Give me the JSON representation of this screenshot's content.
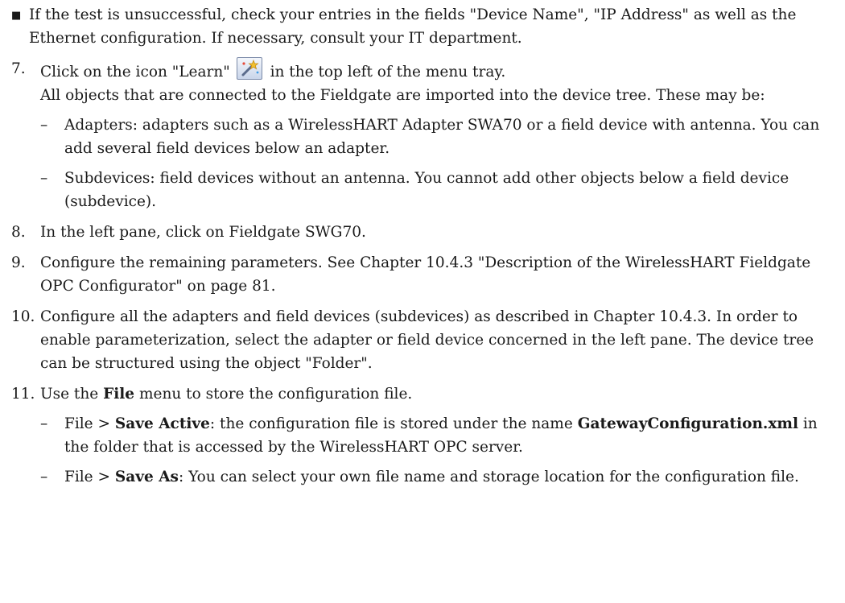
{
  "bullet": {
    "text": "If the test is unsuccessful, check your entries in the fields \"Device Name\", \"IP Address\" as well as the Ethernet configuration. If necessary, consult your IT department."
  },
  "step7": {
    "num": "7.",
    "line1_before": "Click on the icon \"Learn\"",
    "line1_after": "in the top left of the menu tray.",
    "line2": "All objects that are connected to the Fieldgate are imported into the device tree. These may be:",
    "icon": "learn-wand-icon",
    "subs": [
      {
        "dash": "–",
        "text": "Adapters: adapters such as a WirelessHART Adapter SWA70 or a field device with antenna. You can add several field devices below an adapter."
      },
      {
        "dash": "–",
        "text": "Subdevices: field devices without an antenna. You cannot add other objects below a field device (subdevice)."
      }
    ]
  },
  "step8": {
    "num": "8.",
    "text": "In the left pane, click on Fieldgate SWG70."
  },
  "step9": {
    "num": "9.",
    "text": "Configure the remaining parameters. See Chapter 10.4.3 \"Description of the WirelessHART Fieldgate OPC Configurator\" on page 81."
  },
  "step10": {
    "num": "10.",
    "text": "Configure all the adapters and field devices (subdevices) as described in Chapter 10.4.3. In order to enable parameterization, select the adapter or field device concerned in the left pane. The device tree can be structured using the object \"Folder\"."
  },
  "step11": {
    "num": "11.",
    "pre": "Use the",
    "bold": "File",
    "post": "menu to store the configuration file.",
    "subs": [
      {
        "dash": "–",
        "pre": "File >",
        "bold1": "Save Active",
        "mid": ": the configuration file is stored under the name",
        "bold2": "GatewayConfiguration.xml",
        "post": "in the folder that is accessed by the WirelessHART OPC server."
      },
      {
        "dash": "–",
        "pre": "File >",
        "bold1": "Save As",
        "post": ": You can select your own file name and storage location for the configuration file."
      }
    ]
  }
}
